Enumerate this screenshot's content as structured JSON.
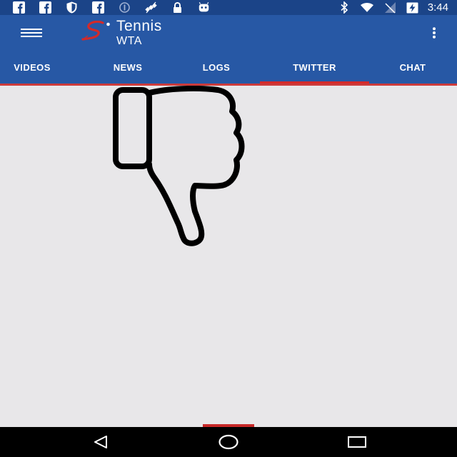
{
  "status_bar": {
    "time": "3:44",
    "left_icons": [
      "facebook-icon",
      "facebook-icon",
      "shield-icon",
      "facebook-icon",
      "sync-icon",
      "satellite-icon",
      "lock-icon",
      "android-icon"
    ],
    "right_icons": [
      "bluetooth-icon",
      "wifi-icon",
      "no-signal-icon",
      "battery-charging-icon"
    ]
  },
  "app_bar": {
    "title": "Tennis",
    "subtitle": "WTA"
  },
  "tabs": [
    {
      "label": "VIDEOS"
    },
    {
      "label": "NEWS"
    },
    {
      "label": "LOGS"
    },
    {
      "label": "TWITTER",
      "selected": true
    },
    {
      "label": "CHAT"
    }
  ],
  "content": {
    "icon": "thumbs-down-icon"
  },
  "colors": {
    "status_bar": "#1b4488",
    "app_bar": "#2758a5",
    "accent": "#d42a2a",
    "background": "#e8e7e9"
  }
}
